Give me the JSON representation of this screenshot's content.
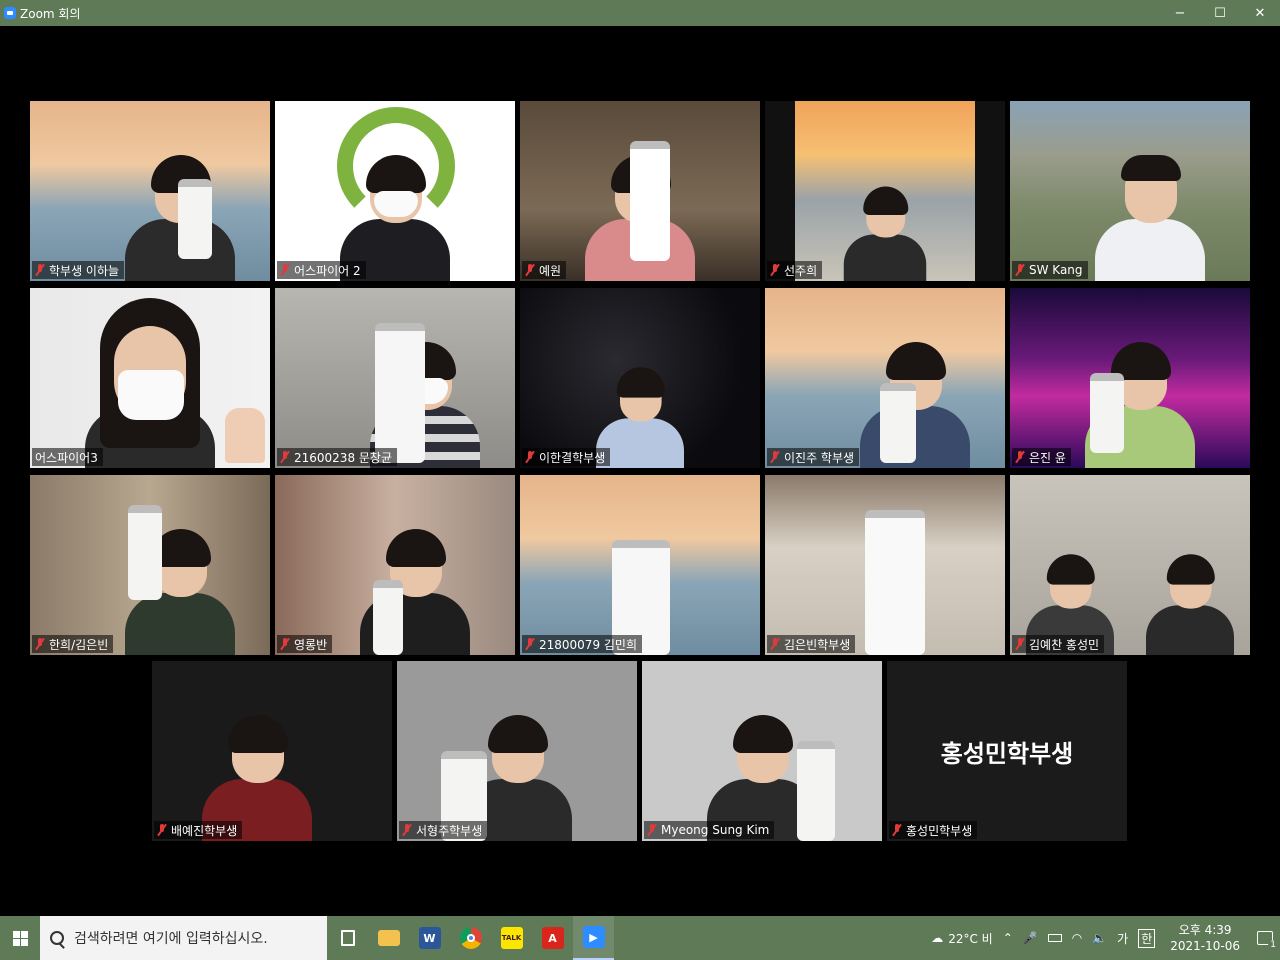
{
  "window": {
    "title": "Zoom 회의",
    "minimize": "−",
    "maximize": "☐",
    "close": "✕"
  },
  "participants": [
    {
      "name": "학부생 이하늘",
      "muted": true
    },
    {
      "name": "어스파이어 2",
      "muted": true
    },
    {
      "name": "예원",
      "muted": true
    },
    {
      "name": "선주희",
      "muted": true
    },
    {
      "name": "SW Kang",
      "muted": true
    },
    {
      "name": "어스파이어3",
      "muted": false,
      "active_speaker": true
    },
    {
      "name": "21600238 문창균",
      "muted": true
    },
    {
      "name": "이한결학부생",
      "muted": true
    },
    {
      "name": "이진주 학부생",
      "muted": true
    },
    {
      "name": "은진 윤",
      "muted": true
    },
    {
      "name": "한희/김은빈",
      "muted": true
    },
    {
      "name": "영롱반",
      "muted": true
    },
    {
      "name": "21800079 김민희",
      "muted": true
    },
    {
      "name": "김은빈학부생",
      "muted": true
    },
    {
      "name": "김예찬 홍성민",
      "muted": true
    },
    {
      "name": "배예진학부생",
      "muted": true
    },
    {
      "name": "서형주학부생",
      "muted": true
    },
    {
      "name": "Myeong Sung Kim",
      "muted": true
    },
    {
      "name": "홍성민학부생",
      "muted": true,
      "video_off": true,
      "display_name": "홍성민학부생"
    }
  ],
  "taskbar": {
    "search_placeholder": "검색하려면 여기에 입력하십시오.",
    "apps": [
      "task-view",
      "file-explorer",
      "word",
      "chrome",
      "kakaotalk",
      "acrobat",
      "zoom"
    ],
    "weather": "22°C  비",
    "ime": "가",
    "ime_mode": "한",
    "time": "오후 4:39",
    "date": "2021-10-06",
    "notification_count": "1"
  }
}
